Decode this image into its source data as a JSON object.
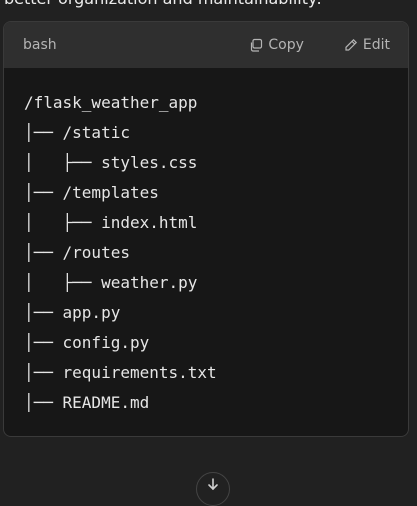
{
  "top_text": "better organization and maintainability:",
  "code_block": {
    "language": "bash",
    "copy_label": "Copy",
    "edit_label": "Edit",
    "lines": [
      "/flask_weather_app",
      "│── /static",
      "│   ├── styles.css",
      "│── /templates",
      "│   ├── index.html",
      "│── /routes",
      "│   ├── weather.py",
      "│── app.py",
      "│── config.py",
      "│── requirements.txt",
      "│── README.md"
    ]
  },
  "icons": {
    "copy": "copy-icon",
    "edit": "pencil-icon",
    "bottom": "arrow-down-icon"
  }
}
